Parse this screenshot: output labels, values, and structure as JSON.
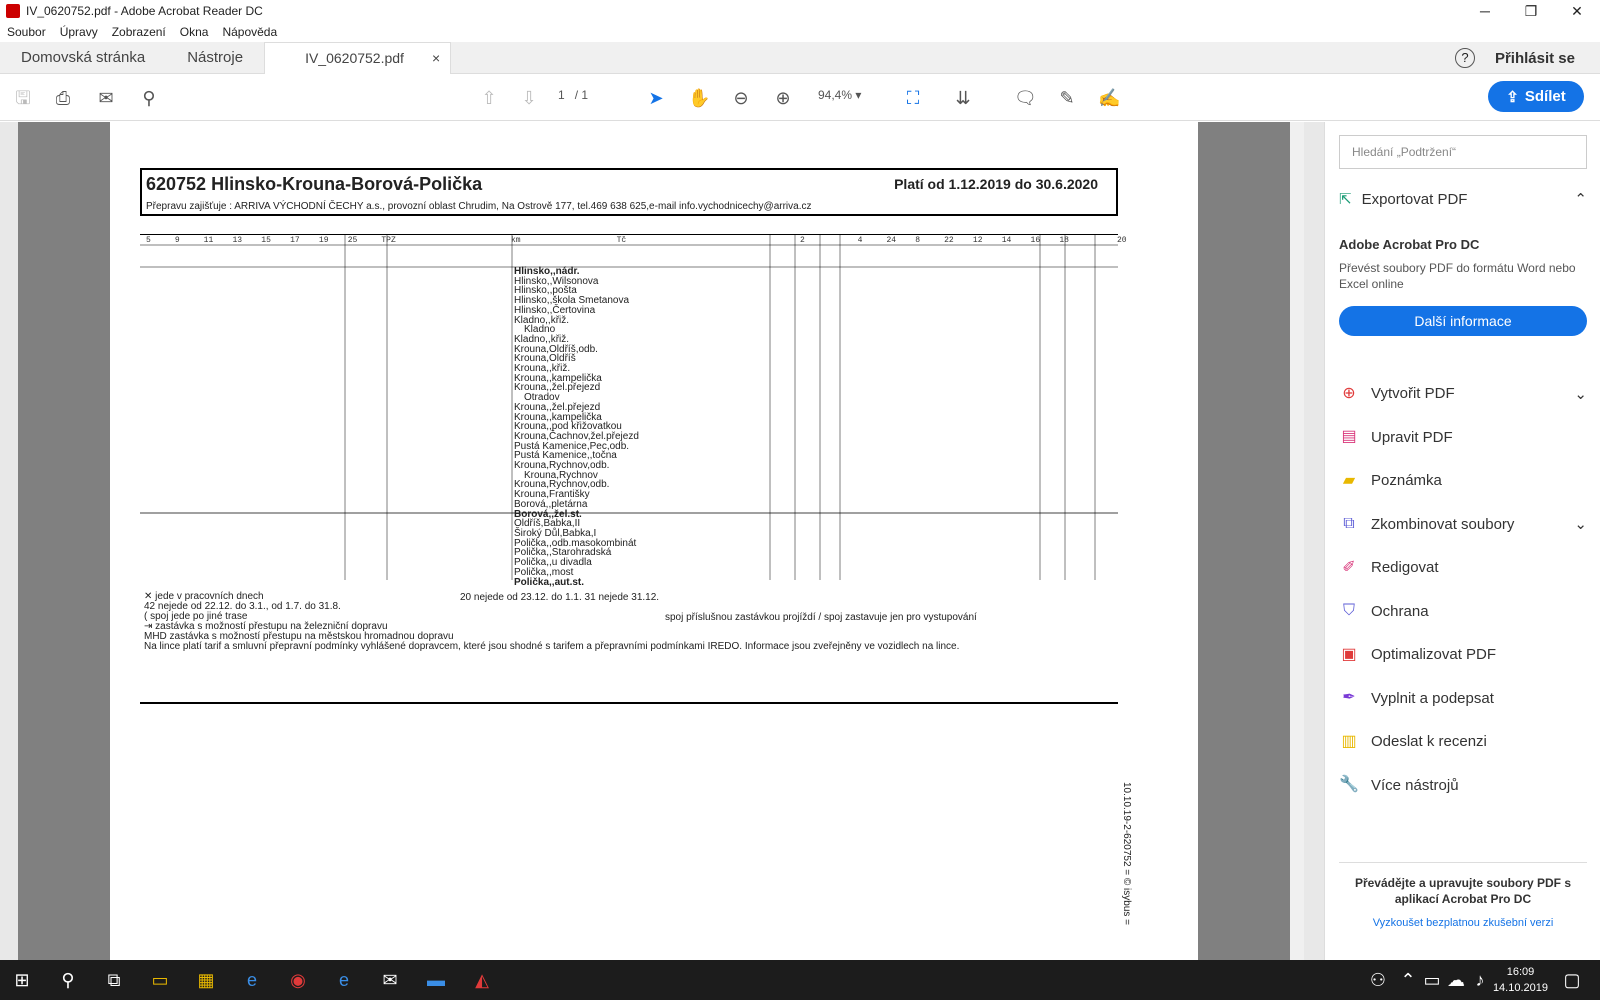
{
  "window": {
    "title": "IV_0620752.pdf - Adobe Acrobat Reader DC",
    "min": "─",
    "max": "❐",
    "close": "✕"
  },
  "menu": [
    "Soubor",
    "Úpravy",
    "Zobrazení",
    "Okna",
    "Nápověda"
  ],
  "tabs": {
    "home": "Domovská stránka",
    "tools": "Nástroje",
    "file": "IV_0620752.pdf",
    "close": "×",
    "help": "?",
    "signin": "Přihlásit se"
  },
  "toolbar": {
    "page": "1",
    "pages": "/ 1",
    "zoom": "94,4%",
    "share": "Sdílet"
  },
  "panel": {
    "search_placeholder": "Hledání „Podtržení“",
    "export": "Exportovat PDF",
    "promo_title": "Adobe Acrobat Pro DC",
    "promo_text": "Převést soubory PDF do formátu Word nebo Excel online",
    "more": "Další informace",
    "tools": [
      "Vytvořit PDF",
      "Upravit PDF",
      "Poznámka",
      "Zkombinovat soubory",
      "Redigovat",
      "Ochrana",
      "Optimalizovat PDF",
      "Vyplnit a podepsat",
      "Odeslat k recenzi",
      "Více nástrojů"
    ],
    "footer": "Převádějte a upravujte soubory PDF s aplikací Acrobat Pro DC",
    "trial": "Vyzkoušet bezplatnou zkušební verzi"
  },
  "doc": {
    "route": "620752  Hlinsko-Krouna-Borová-Polička",
    "valid": "Platí od 1.12.2019 do 30.6.2020",
    "carrier": "Přepravu zajišťuje   : ARRIVA VÝCHODNÍ ČECHY a.s., provozní oblast Chrudim, Na Ostrově 177, tel.469 638 625,e-mail info.vychodnicechy@arriva.cz",
    "col_headers": [
      "5",
      "9",
      "11",
      "13",
      "15",
      "17",
      "19",
      "25",
      "TPZ",
      "km",
      "Tč",
      "2",
      "4",
      "24",
      "8",
      "22",
      "12",
      "14",
      "16",
      "18",
      "20"
    ],
    "stops": [
      "Hlinsko,,nádr.",
      "Hlinsko,,Wilsonova",
      "Hlinsko,,pošta",
      "Hlinsko,,škola Smetanova",
      "Hlinsko,,Čertovina",
      "Kladno,,křiž.",
      "Kladno",
      "Kladno,,křiž.",
      "Krouna,Oldříš,odb.",
      "Krouna,Oldříš",
      "Krouna,,křiž.",
      "Krouna,,kampelička",
      "Krouna,,žel.přejezd",
      "Otradov",
      "Krouna,,žel.přejezd",
      "Krouna,,kampelička",
      "Krouna,,pod křižovatkou",
      "Krouna,Čachnov,žel.přejezd",
      "Pustá Kamenice,Pec,odb.",
      "Pustá Kamenice,,točna",
      "Krouna,Rychnov,odb.",
      "Krouna,Rychnov",
      "Krouna,Rychnov,odb.",
      "Krouna,Františky",
      "Borová,,pletárna",
      "Borová,,žel.st.",
      "Oldříš,Babka,II",
      "Široký Důl,Babka,I",
      "Polička,,odb.masokombinát",
      "Polička,,Starohradská",
      "Polička,,u divadla",
      "Polička,,most",
      "Polička,,aut.st."
    ],
    "legend": [
      "✕      jede v pracovních dnech",
      "42     nejede od 22.12. do 3.1., od 1.7. do 31.8.",
      "(       spoj jede po jiné trase",
      "⇥      zastávka s možností přestupu na železniční dopravu",
      "MHD   zastávka s možností přestupu na městskou hromadnou dopravu",
      "Na lince platí tarif a smluvní přepravní podmínky vyhlášené dopravcem, které jsou shodné s tarifem a přepravními podmínkami IREDO. Informace jsou zveřejněny ve vozidlech na lince."
    ],
    "legend2": "20   nejede od 23.12. do 1.1.        31   nejede 31.12.",
    "legend3": "spoj příslušnou zastávkou projíždí  /  spoj zastavuje jen pro vystupování",
    "side": "10.10.19-2-620752 = © isybus ="
  },
  "taskbar": {
    "time": "16:09",
    "date": "14.10.2019"
  }
}
